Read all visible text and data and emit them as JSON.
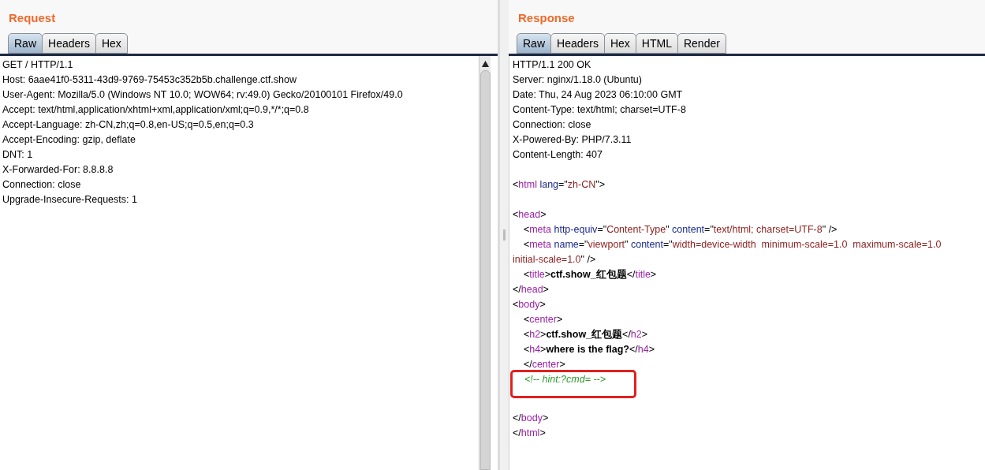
{
  "request": {
    "title": "Request",
    "tabs": [
      {
        "label": "Raw",
        "selected": true
      },
      {
        "label": "Headers",
        "selected": false
      },
      {
        "label": "Hex",
        "selected": false
      }
    ],
    "lines": [
      "GET / HTTP/1.1",
      "Host: 6aae41f0-5311-43d9-9769-75453c352b5b.challenge.ctf.show",
      "User-Agent: Mozilla/5.0 (Windows NT 10.0; WOW64; rv:49.0) Gecko/20100101 Firefox/49.0",
      "Accept: text/html,application/xhtml+xml,application/xml;q=0.9,*/*;q=0.8",
      "Accept-Language: zh-CN,zh;q=0.8,en-US;q=0.5,en;q=0.3",
      "Accept-Encoding: gzip, deflate",
      "DNT: 1",
      "X-Forwarded-For: 8.8.8.8",
      "Connection: close",
      "Upgrade-Insecure-Requests: 1"
    ]
  },
  "response": {
    "title": "Response",
    "tabs": [
      {
        "label": "Raw",
        "selected": true
      },
      {
        "label": "Headers",
        "selected": false
      },
      {
        "label": "Hex",
        "selected": false
      },
      {
        "label": "HTML",
        "selected": false
      },
      {
        "label": "Render",
        "selected": false
      }
    ],
    "blocks": [
      {
        "lines": [
          {
            "highlighted": false,
            "tokens": [
              {
                "kind": "plain",
                "text": "HTTP/1.1 200 OK"
              }
            ]
          },
          {
            "highlighted": false,
            "tokens": [
              {
                "kind": "plain",
                "text": "Server: nginx/1.18.0 (Ubuntu)"
              }
            ]
          },
          {
            "highlighted": false,
            "tokens": [
              {
                "kind": "plain",
                "text": "Date: Thu, 24 Aug 2023 06:10:00 GMT"
              }
            ]
          },
          {
            "highlighted": false,
            "tokens": [
              {
                "kind": "plain",
                "text": "Content-Type: text/html; charset=UTF-8"
              }
            ]
          },
          {
            "highlighted": false,
            "tokens": [
              {
                "kind": "plain",
                "text": "Connection: close"
              }
            ]
          },
          {
            "highlighted": false,
            "tokens": [
              {
                "kind": "plain",
                "text": "X-Powered-By: PHP/7.3.11"
              }
            ]
          },
          {
            "highlighted": false,
            "tokens": [
              {
                "kind": "plain",
                "text": "Content-Length: 407"
              }
            ]
          }
        ]
      },
      {
        "lines": [
          {
            "highlighted": false,
            "tokens": [
              {
                "kind": "plain",
                "text": "<"
              },
              {
                "kind": "tag",
                "text": "html"
              },
              {
                "kind": "attr",
                "text": " lang"
              },
              {
                "kind": "plain",
                "text": "=\""
              },
              {
                "kind": "value",
                "text": "zh-CN"
              },
              {
                "kind": "plain",
                "text": "\">"
              }
            ]
          }
        ]
      },
      {
        "lines": [
          {
            "highlighted": false,
            "tokens": [
              {
                "kind": "plain",
                "text": "<"
              },
              {
                "kind": "tag",
                "text": "head"
              },
              {
                "kind": "plain",
                "text": ">"
              }
            ]
          },
          {
            "highlighted": false,
            "tokens": [
              {
                "kind": "plain",
                "text": "    <"
              },
              {
                "kind": "tag",
                "text": "meta"
              },
              {
                "kind": "attr",
                "text": " http-equiv"
              },
              {
                "kind": "plain",
                "text": "=\""
              },
              {
                "kind": "value",
                "text": "Content-Type"
              },
              {
                "kind": "plain",
                "text": "\""
              },
              {
                "kind": "attr",
                "text": " content"
              },
              {
                "kind": "plain",
                "text": "=\""
              },
              {
                "kind": "value",
                "text": "text/html; charset=UTF-8"
              },
              {
                "kind": "plain",
                "text": "\" />"
              }
            ]
          },
          {
            "highlighted": false,
            "tokens": [
              {
                "kind": "plain",
                "text": "    <"
              },
              {
                "kind": "tag",
                "text": "meta"
              },
              {
                "kind": "attr",
                "text": " name"
              },
              {
                "kind": "plain",
                "text": "=\""
              },
              {
                "kind": "value",
                "text": "viewport"
              },
              {
                "kind": "plain",
                "text": "\""
              },
              {
                "kind": "attr",
                "text": " content"
              },
              {
                "kind": "plain",
                "text": "=\""
              },
              {
                "kind": "value",
                "text": "width=device-width  minimum-scale=1.0  maximum-scale=1.0"
              }
            ]
          },
          {
            "highlighted": false,
            "tokens": [
              {
                "kind": "value",
                "text": "initial-scale=1.0"
              },
              {
                "kind": "plain",
                "text": "\" />"
              }
            ]
          },
          {
            "highlighted": false,
            "tokens": [
              {
                "kind": "plain",
                "text": "    <"
              },
              {
                "kind": "tag",
                "text": "title"
              },
              {
                "kind": "plain",
                "text": ">"
              },
              {
                "kind": "bold",
                "text": "ctf.show_红包题"
              },
              {
                "kind": "plain",
                "text": "</"
              },
              {
                "kind": "tag",
                "text": "title"
              },
              {
                "kind": "plain",
                "text": ">"
              }
            ]
          },
          {
            "highlighted": false,
            "tokens": [
              {
                "kind": "plain",
                "text": "</"
              },
              {
                "kind": "tag",
                "text": "head"
              },
              {
                "kind": "plain",
                "text": ">"
              }
            ]
          },
          {
            "highlighted": false,
            "tokens": [
              {
                "kind": "plain",
                "text": "<"
              },
              {
                "kind": "tag",
                "text": "body"
              },
              {
                "kind": "plain",
                "text": ">"
              }
            ]
          },
          {
            "highlighted": false,
            "tokens": [
              {
                "kind": "plain",
                "text": "    <"
              },
              {
                "kind": "tag",
                "text": "center"
              },
              {
                "kind": "plain",
                "text": ">"
              }
            ]
          },
          {
            "highlighted": false,
            "tokens": [
              {
                "kind": "plain",
                "text": "    <"
              },
              {
                "kind": "tag",
                "text": "h2"
              },
              {
                "kind": "plain",
                "text": ">"
              },
              {
                "kind": "bold",
                "text": "ctf.show_红包题"
              },
              {
                "kind": "plain",
                "text": "</"
              },
              {
                "kind": "tag",
                "text": "h2"
              },
              {
                "kind": "plain",
                "text": ">"
              }
            ]
          },
          {
            "highlighted": false,
            "tokens": [
              {
                "kind": "plain",
                "text": "    <"
              },
              {
                "kind": "tag",
                "text": "h4"
              },
              {
                "kind": "plain",
                "text": ">"
              },
              {
                "kind": "bold",
                "text": "where is the flag?"
              },
              {
                "kind": "plain",
                "text": "</"
              },
              {
                "kind": "tag",
                "text": "h4"
              },
              {
                "kind": "plain",
                "text": ">"
              }
            ]
          },
          {
            "highlighted": false,
            "tokens": [
              {
                "kind": "plain",
                "text": "    </"
              },
              {
                "kind": "tag",
                "text": "center"
              },
              {
                "kind": "plain",
                "text": ">"
              }
            ]
          },
          {
            "highlighted": true,
            "tokens": [
              {
                "kind": "comment",
                "text": "    <!-- hint:?cmd= -->"
              }
            ]
          },
          {
            "highlighted": false,
            "tokens": [
              {
                "kind": "plain",
                "text": "</"
              },
              {
                "kind": "tag",
                "text": "body"
              },
              {
                "kind": "plain",
                "text": ">"
              }
            ]
          },
          {
            "highlighted": false,
            "tokens": [
              {
                "kind": "plain",
                "text": "</"
              },
              {
                "kind": "tag",
                "text": "html"
              },
              {
                "kind": "plain",
                "text": ">"
              }
            ]
          }
        ]
      }
    ]
  }
}
